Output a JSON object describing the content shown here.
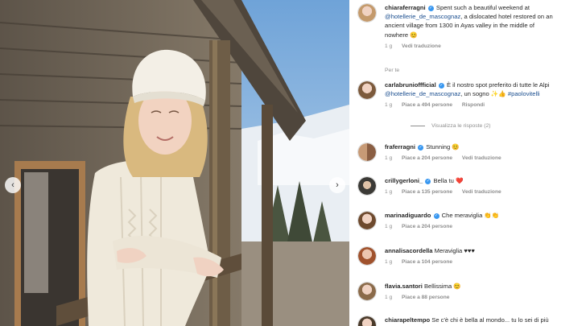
{
  "post": {
    "caption": {
      "username": "chiaraferragni",
      "lines": [
        "Spent such a beautiful weekend at",
        "@hotellerie_de_mascognaz",
        ", a dislocated hotel restored on an",
        "ancient village from 1300 in Ayas valley in the middle of",
        "nowhere 😊"
      ],
      "time": "1 g",
      "translate": "Vedi traduzione"
    },
    "translated_by": "Per te"
  },
  "comments": [
    {
      "username": "carlabrunioffficial",
      "verified": true,
      "line1": "È il nostro spot preferito di tutte le Alpi",
      "mention": "@hotellerie_de_mascognaz",
      "line2_rest": ", un sogno ✨👍",
      "hashtag": "#paolovitelli",
      "time": "1 g",
      "likes": "Piace a 494 persone",
      "reply": "Rispondi",
      "view_replies": "Visualizza le risposte (2)"
    },
    {
      "username": "fraferragni",
      "verified": true,
      "text": "Stunning 😊",
      "time": "1 g",
      "likes": "Piace a 204 persone",
      "translate": "Vedi traduzione"
    },
    {
      "username": "crillygerloni_",
      "verified": true,
      "text": "Bella tu ❤️",
      "time": "1 g",
      "likes": "Piace a 135 persone",
      "translate": "Vedi traduzione"
    },
    {
      "username": "marinadiguardo",
      "verified": true,
      "text": "Che meraviglia 👏👏",
      "time": "1 g",
      "likes": "Piace a 204 persone"
    },
    {
      "username": "annalisacordella",
      "verified": false,
      "text": "Meraviglia ♥♥♥",
      "time": "1 g",
      "likes": "Piace a 104 persone"
    },
    {
      "username": "flavia.santori",
      "verified": false,
      "text": "Bellissima 😊",
      "time": "1 g",
      "likes": "Piace a 88 persone"
    },
    {
      "username": "chiarapeltempo",
      "verified": false,
      "text": "Se c'è chi è bella al mondo... tu lo sei di più",
      "time": "",
      "likes": ""
    }
  ],
  "icons": {
    "nav_left": "chevron-left-icon",
    "nav_right": "chevron-right-icon",
    "verified": "verified-badge-icon",
    "like": "heart-icon"
  },
  "colors": {
    "verified_blue": "#3897f0",
    "mention_blue": "#1a4e8f",
    "meta_gray": "#8e8e8e",
    "text_dark": "#262626"
  }
}
